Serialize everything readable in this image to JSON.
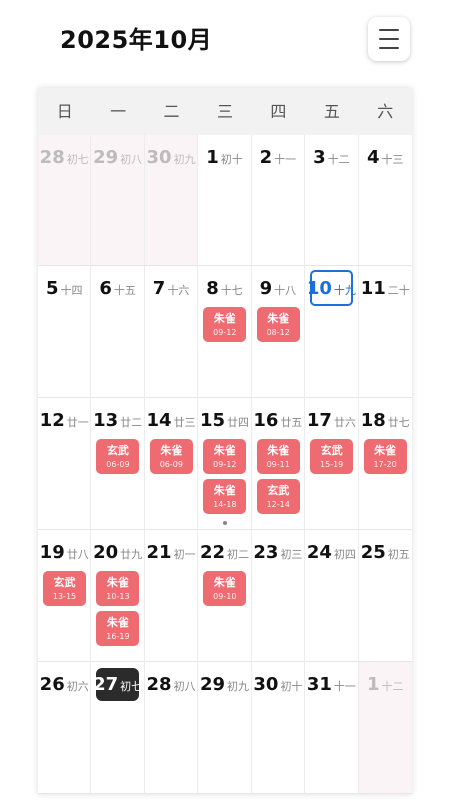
{
  "header": {
    "title": "2025年10月",
    "menu_icon": "menu-icon"
  },
  "colors": {
    "event": "#ee6b72",
    "today": "#1e6fd9",
    "selected": "#2b2b2b"
  },
  "weekdays": [
    "日",
    "一",
    "二",
    "三",
    "四",
    "五",
    "六"
  ],
  "weeks": [
    [
      {
        "day": "28",
        "lunar": "初七",
        "muted": true
      },
      {
        "day": "29",
        "lunar": "初八",
        "muted": true
      },
      {
        "day": "30",
        "lunar": "初九",
        "muted": true
      },
      {
        "day": "1",
        "lunar": "初十"
      },
      {
        "day": "2",
        "lunar": "十一"
      },
      {
        "day": "3",
        "lunar": "十二"
      },
      {
        "day": "4",
        "lunar": "十三"
      }
    ],
    [
      {
        "day": "5",
        "lunar": "十四"
      },
      {
        "day": "6",
        "lunar": "十五"
      },
      {
        "day": "7",
        "lunar": "十六"
      },
      {
        "day": "8",
        "lunar": "十七",
        "events": [
          {
            "name": "朱雀",
            "time": "09-12"
          }
        ]
      },
      {
        "day": "9",
        "lunar": "十八",
        "events": [
          {
            "name": "朱雀",
            "time": "08-12"
          }
        ]
      },
      {
        "day": "10",
        "lunar": "十九",
        "today": true
      },
      {
        "day": "11",
        "lunar": "二十"
      }
    ],
    [
      {
        "day": "12",
        "lunar": "廿一"
      },
      {
        "day": "13",
        "lunar": "廿二",
        "events": [
          {
            "name": "玄武",
            "time": "06-09"
          }
        ]
      },
      {
        "day": "14",
        "lunar": "廿三",
        "events": [
          {
            "name": "朱雀",
            "time": "06-09"
          }
        ]
      },
      {
        "day": "15",
        "lunar": "廿四",
        "events": [
          {
            "name": "朱雀",
            "time": "09-12"
          },
          {
            "name": "朱雀",
            "time": "14-18"
          }
        ],
        "more": true
      },
      {
        "day": "16",
        "lunar": "廿五",
        "events": [
          {
            "name": "朱雀",
            "time": "09-11"
          },
          {
            "name": "玄武",
            "time": "12-14"
          }
        ]
      },
      {
        "day": "17",
        "lunar": "廿六",
        "events": [
          {
            "name": "玄武",
            "time": "15-19"
          }
        ]
      },
      {
        "day": "18",
        "lunar": "廿七",
        "events": [
          {
            "name": "朱雀",
            "time": "17-20"
          }
        ]
      }
    ],
    [
      {
        "day": "19",
        "lunar": "廿八",
        "events": [
          {
            "name": "玄武",
            "time": "13-15"
          }
        ]
      },
      {
        "day": "20",
        "lunar": "廿九",
        "events": [
          {
            "name": "朱雀",
            "time": "10-13"
          },
          {
            "name": "朱雀",
            "time": "16-19"
          }
        ]
      },
      {
        "day": "21",
        "lunar": "初一"
      },
      {
        "day": "22",
        "lunar": "初二",
        "events": [
          {
            "name": "朱雀",
            "time": "09-10"
          }
        ]
      },
      {
        "day": "23",
        "lunar": "初三"
      },
      {
        "day": "24",
        "lunar": "初四"
      },
      {
        "day": "25",
        "lunar": "初五"
      }
    ],
    [
      {
        "day": "26",
        "lunar": "初六"
      },
      {
        "day": "27",
        "lunar": "初七",
        "selected": true
      },
      {
        "day": "28",
        "lunar": "初八"
      },
      {
        "day": "29",
        "lunar": "初九"
      },
      {
        "day": "30",
        "lunar": "初十"
      },
      {
        "day": "31",
        "lunar": "十一"
      },
      {
        "day": "1",
        "lunar": "十二",
        "muted": true
      }
    ]
  ]
}
